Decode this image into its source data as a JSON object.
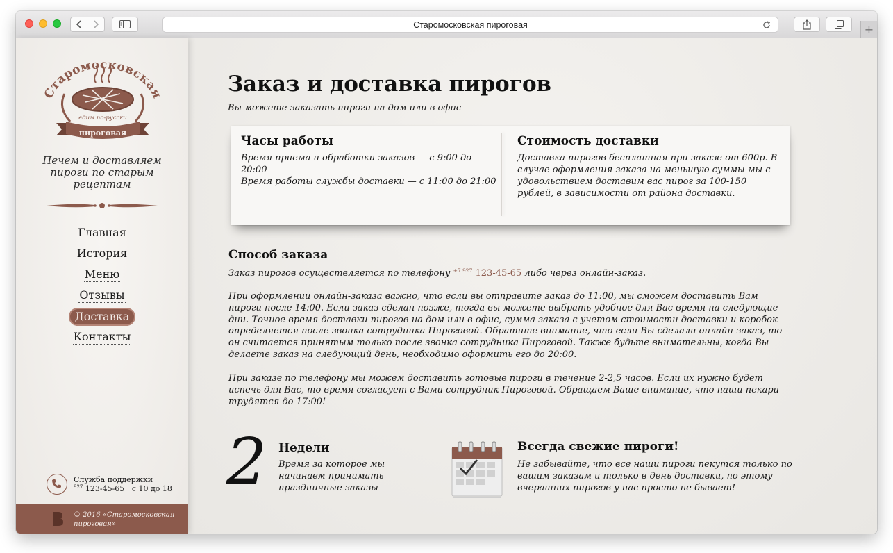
{
  "browser": {
    "page_title": "Старомосковская пироговая"
  },
  "sidebar": {
    "logo_text_top": "Старомосковская",
    "logo_text_mid": "едим по-русски",
    "logo_text_bottom": "пироговая",
    "tagline": "Печем и доставляем пироги по старым рецептам",
    "menu": [
      {
        "label": "Главная",
        "active": false
      },
      {
        "label": "История",
        "active": false
      },
      {
        "label": "Меню",
        "active": false
      },
      {
        "label": "Отзывы",
        "active": false
      },
      {
        "label": "Доставка",
        "active": true
      },
      {
        "label": "Контакты",
        "active": false
      }
    ],
    "support": {
      "title": "Служба поддержки",
      "phone_code": "927",
      "phone": "123-45-65",
      "hours": "с 10 до 18"
    },
    "footer": {
      "copyright": "© 2016 «Старомосковская пироговая»"
    }
  },
  "main": {
    "title": "Заказ и доставка пирогов",
    "subtitle": "Вы можете заказать пироги на дом или в офис",
    "hours": {
      "title": "Часы работы",
      "line1": "Время приема и обработки заказов — с 9:00 до 20:00",
      "line2": "Время работы службы доставки — с 11:00 до 21:00"
    },
    "delivery_cost": {
      "title": "Стоимость доставки",
      "text": "Доставка пирогов бесплатная при заказе от 600р. В случае оформления заказа на меньшую суммы мы с удовольствием доставим вас пирог за 100-150 рублей, в зависимости от района доставки."
    },
    "order_method": {
      "title": "Способ заказа",
      "line_before": "Заказ пирогов осуществляется по телефону ",
      "phone_code": "+7 927",
      "phone": "123-45-65",
      "line_after": " либо через онлайн-заказ.",
      "paragraph1": "При оформлении онлайн-заказа важно, что если вы отправите заказ до 11:00, мы сможем доставить Вам пироги после 14:00. Если заказ сделан позже, тогда вы можете выбрать удобное для Вас время на следующие дни. Точное время доставки пирогов на дом или в офис, сумма заказа с учетом стоимости доставки и коробок определяется после звонка сотрудника Пироговой. Обратите внимание, что если Вы сделали онлайн-заказ, то он считается принятым только после звонка сотрудника Пироговой. Также будьте внимательны, когда Вы делаете заказ на следующий день, необходимо оформить его до 20:00.",
      "paragraph2": "При заказе по телефону мы можем доставить готовые пироги в течение 2-2,5 часов. Если их нужно будет испечь для Вас, то время согласует с Вами сотрудник Пироговой. Обращаем Ваше внимание, что наши пекари трудятся до 17:00!"
    },
    "feature_weeks": {
      "number": "2",
      "title": "Недели",
      "text": "Время за которое мы начинаем принимать праздничные заказы"
    },
    "feature_fresh": {
      "title": "Всегда свежие пироги!",
      "text": "Не забывайте, что все наши пироги пекутся только по вашим заказам и только в день доставки, по этому вчерашних пирогов у нас просто не бывает!"
    }
  },
  "colors": {
    "brand": "#8c5a4c",
    "text": "#1a1a1a"
  }
}
